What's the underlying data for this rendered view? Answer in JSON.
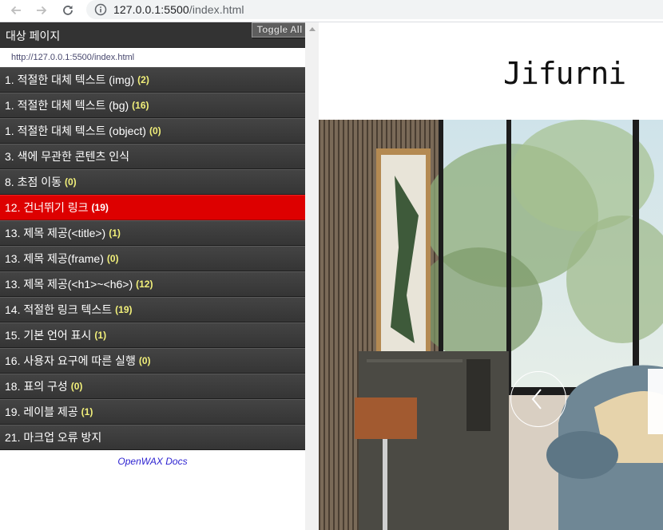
{
  "browser": {
    "url_host": "127.0.0.1:5500",
    "url_path": "/index.html",
    "icons": [
      "back-arrow-icon",
      "forward-arrow-icon",
      "reload-icon",
      "info-icon"
    ]
  },
  "sidebar": {
    "header_title": "대상 페이지",
    "toggle_label": "Toggle All",
    "target_url": "http://127.0.0.1:5500/index.html",
    "items": [
      {
        "label": "1. 적절한 대체 텍스트 (img)",
        "count": "(2)"
      },
      {
        "label": "1. 적절한 대체 텍스트 (bg)",
        "count": "(16)"
      },
      {
        "label": "1. 적절한 대체 텍스트 (object)",
        "count": "(0)"
      },
      {
        "label": "3. 색에 무관한 콘텐츠 인식",
        "count": ""
      },
      {
        "label": "8. 초점 이동",
        "count": "(0)"
      },
      {
        "label": "12. 건너뛰기 링크",
        "count": "(19)"
      },
      {
        "label": "13. 제목 제공(<title>)",
        "count": "(1)"
      },
      {
        "label": "13. 제목 제공(frame)",
        "count": "(0)"
      },
      {
        "label": "13. 제목 제공(<h1>~<h6>)",
        "count": "(12)"
      },
      {
        "label": "14. 적절한 링크 텍스트",
        "count": "(19)"
      },
      {
        "label": "15. 기본 언어 표시",
        "count": "(1)"
      },
      {
        "label": "16. 사용자 요구에 따른 실행",
        "count": "(0)"
      },
      {
        "label": "18. 표의 구성",
        "count": "(0)"
      },
      {
        "label": "19. 레이블 제공",
        "count": "(1)"
      },
      {
        "label": "21. 마크업 오류 방지",
        "count": ""
      }
    ],
    "active_index": 5,
    "docs_link": "OpenWAX Docs"
  },
  "page": {
    "logo": "Jifurni",
    "hero_heading_partial": "I"
  },
  "colors": {
    "sidebar_bg": "#3c3c3c",
    "active_item": "#dd0000",
    "count_text": "#f2f07a",
    "docs_link": "#2a1fd0"
  }
}
